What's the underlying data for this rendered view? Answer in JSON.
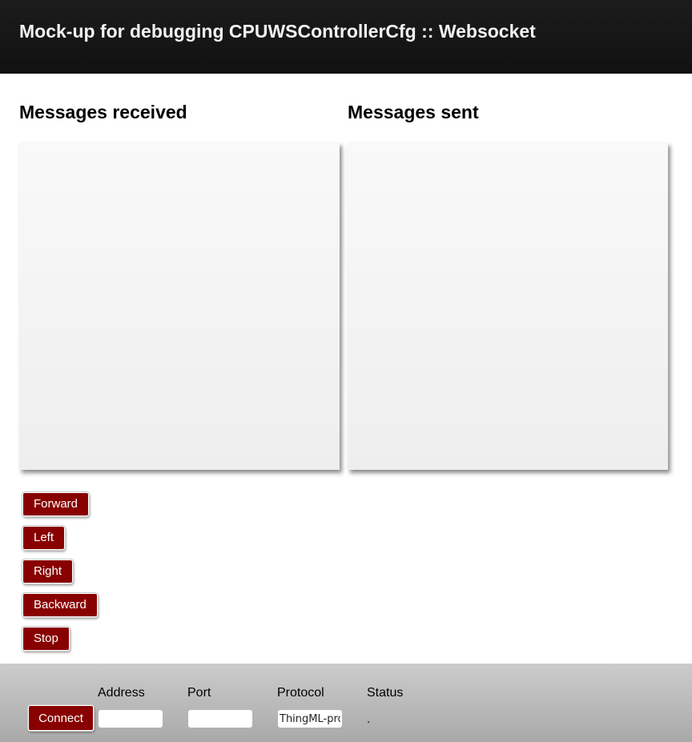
{
  "header": {
    "title": "Mock-up for debugging CPUWSControllerCfg :: Websocket"
  },
  "columns": {
    "received_title": "Messages received",
    "sent_title": "Messages sent"
  },
  "messages": {
    "received": [],
    "sent": []
  },
  "controls": {
    "buttons": [
      {
        "label": "Forward"
      },
      {
        "label": "Left"
      },
      {
        "label": "Right"
      },
      {
        "label": "Backward"
      },
      {
        "label": "Stop"
      }
    ]
  },
  "footer": {
    "connect_label": "Connect",
    "address_label": "Address",
    "address_value": "",
    "port_label": "Port",
    "port_value": "",
    "protocol_label": "Protocol",
    "protocol_value": "ThingML-protocol",
    "status_label": "Status",
    "status_value": "."
  },
  "colors": {
    "button_bg": "#880000",
    "header_bg": "#151515"
  }
}
